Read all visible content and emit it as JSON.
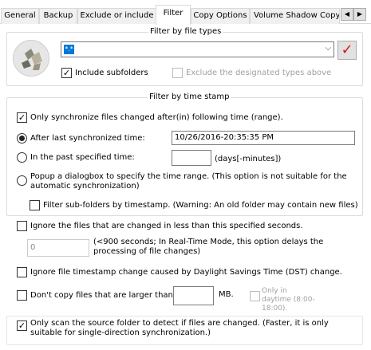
{
  "tabs": [
    "General",
    "Backup",
    "Exclude or include",
    "Filter",
    "Copy Options",
    "Volume Shadow Copy"
  ],
  "tab_nav": {
    "left": "◀",
    "right": "▶"
  },
  "file_types": {
    "legend": "Filter by file types",
    "combo_value": "*.*",
    "combo_arrow": "⌵",
    "check_button": "✓",
    "include_subfolders": {
      "label": "Include subfolders",
      "checked": true
    },
    "exclude_designated": {
      "label": "Exclude the designated types above",
      "checked": false,
      "enabled": false
    }
  },
  "time_stamp": {
    "legend": "Filter by time stamp",
    "only_sync_changed": {
      "label": "Only synchronize files changed after(in) following time (range).",
      "checked": true
    },
    "after_last_sync": {
      "label": "After last synchronized time:",
      "value": "10/26/2016-20:35:35 PM",
      "selected": true
    },
    "past_specified": {
      "label": "In the past specified time:",
      "unit": "(days[-minutes])",
      "selected": false
    },
    "popup_dialog": {
      "label": "Popup a dialogbox to specify the time range. (This option is not suitable for the automatic synchronization)",
      "selected": false
    },
    "filter_subfolders": {
      "label": "Filter sub-folders by timestamp. (Warning: An old folder may contain new files)",
      "checked": false
    }
  },
  "ignore_recent": {
    "label": "Ignore the files that are changed in less than this specified seconds.",
    "checked": false,
    "value": "0",
    "note": "(<900 seconds; In Real-Time Mode, this option delays the processing of file changes)"
  },
  "ignore_dst": {
    "label": "Ignore file timestamp change caused by Daylight Savings Time (DST) change.",
    "checked": false
  },
  "size_limit": {
    "label": "Don't copy files that are larger than",
    "checked": false,
    "unit": "MB.",
    "daytime": {
      "label": "Only in daytime (8:00-18:00).",
      "checked": false,
      "enabled": false
    }
  },
  "scan_source_only": {
    "label": "Only scan the source folder to detect if files are changed. (Faster, it is only suitable for single-direction synchronization.)",
    "checked": true
  },
  "check_mark": "✓"
}
